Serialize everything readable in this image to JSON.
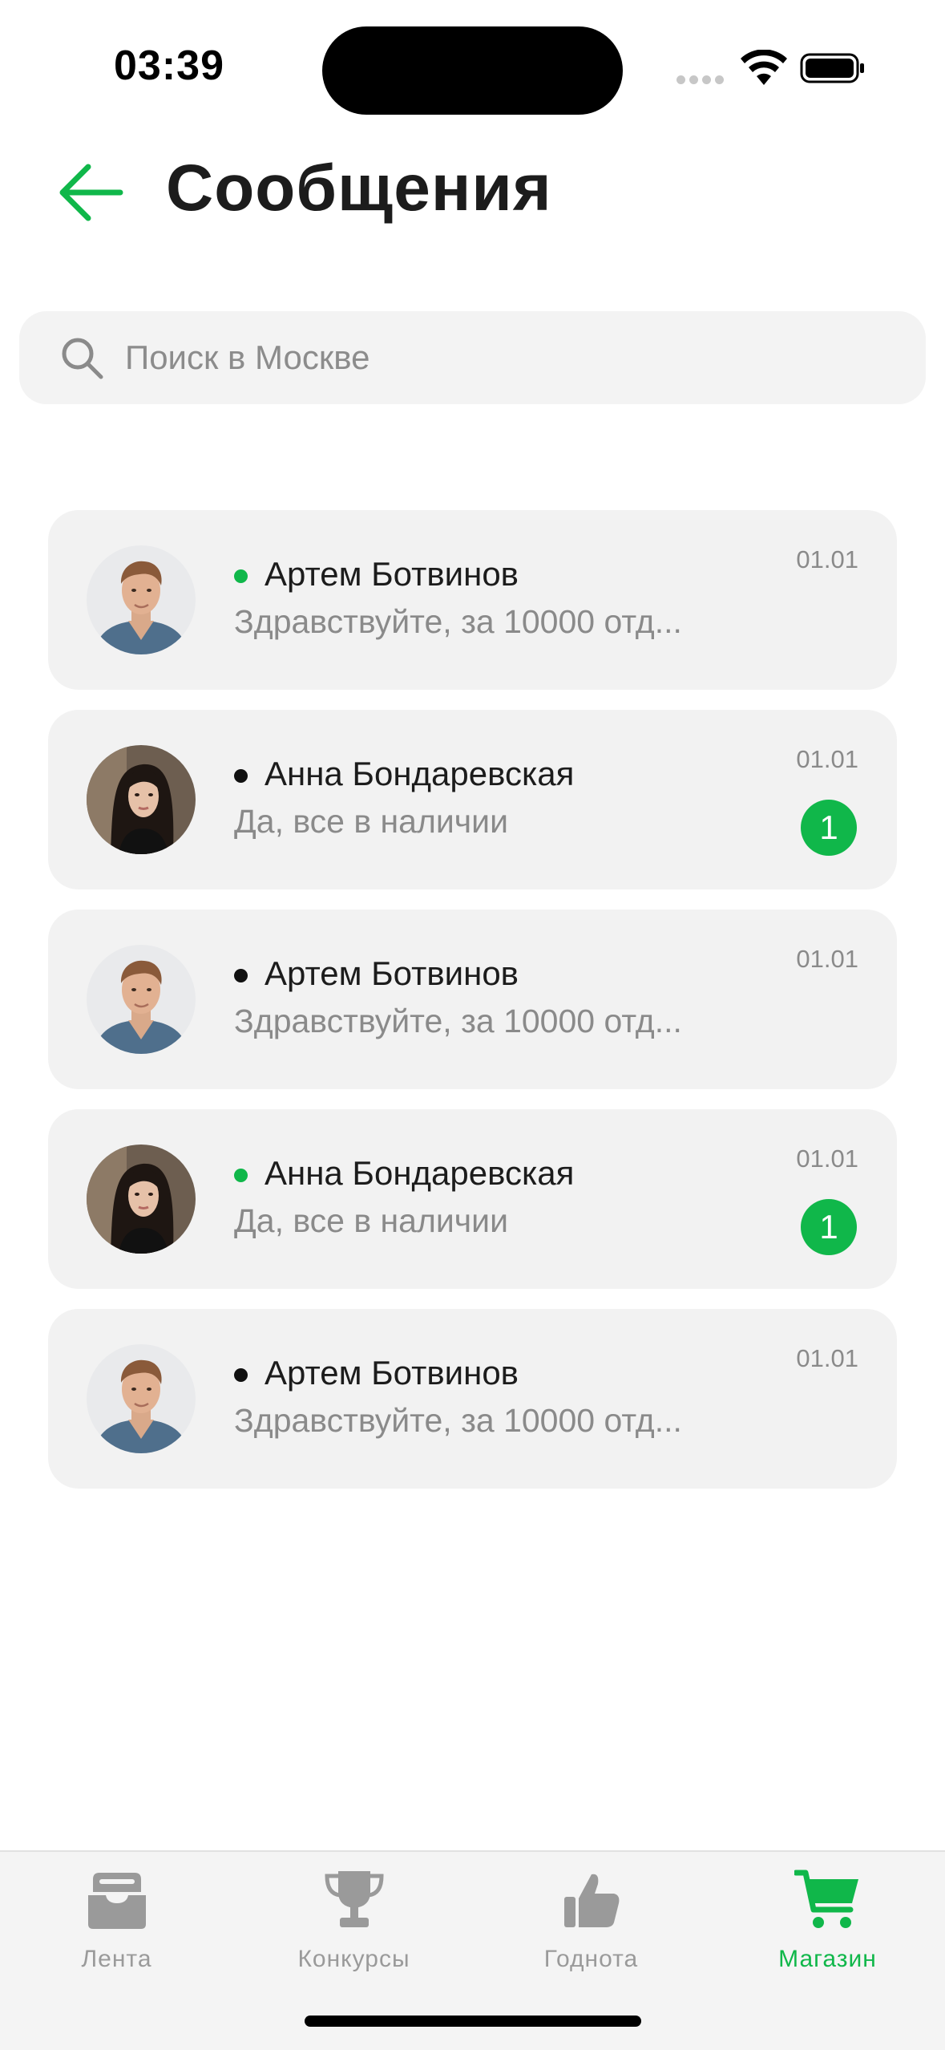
{
  "status_bar": {
    "time": "03:39"
  },
  "header": {
    "title": "Сообщения"
  },
  "search": {
    "placeholder": "Поиск в Москве",
    "value": ""
  },
  "colors": {
    "accent": "#10b74a",
    "online": "#10b74a",
    "offline": "#111111",
    "card_bg": "#f2f2f2"
  },
  "chats": [
    {
      "name": "Артем Ботвинов",
      "preview": "Здравствуйте, за 10000 отд...",
      "date": "01.01",
      "online": true,
      "unread": "",
      "avatar": "male-avatar"
    },
    {
      "name": "Анна Бондаревская",
      "preview": "Да, все в наличии",
      "date": "01.01",
      "online": false,
      "unread": "1",
      "avatar": "female-avatar"
    },
    {
      "name": "Артем Ботвинов",
      "preview": "Здравствуйте, за 10000 отд...",
      "date": "01.01",
      "online": false,
      "unread": "",
      "avatar": "male-avatar"
    },
    {
      "name": "Анна Бондаревская",
      "preview": "Да, все в наличии",
      "date": "01.01",
      "online": true,
      "unread": "1",
      "avatar": "female-avatar"
    },
    {
      "name": "Артем Ботвинов",
      "preview": "Здравствуйте, за 10000 отд...",
      "date": "01.01",
      "online": false,
      "unread": "",
      "avatar": "male-avatar"
    }
  ],
  "tabbar": {
    "tabs": [
      {
        "label": "Лента",
        "icon": "inbox-icon",
        "active": false
      },
      {
        "label": "Конкурсы",
        "icon": "trophy-icon",
        "active": false
      },
      {
        "label": "Годнота",
        "icon": "thumbs-up-icon",
        "active": false
      },
      {
        "label": "Магазин",
        "icon": "cart-icon",
        "active": true
      }
    ]
  }
}
